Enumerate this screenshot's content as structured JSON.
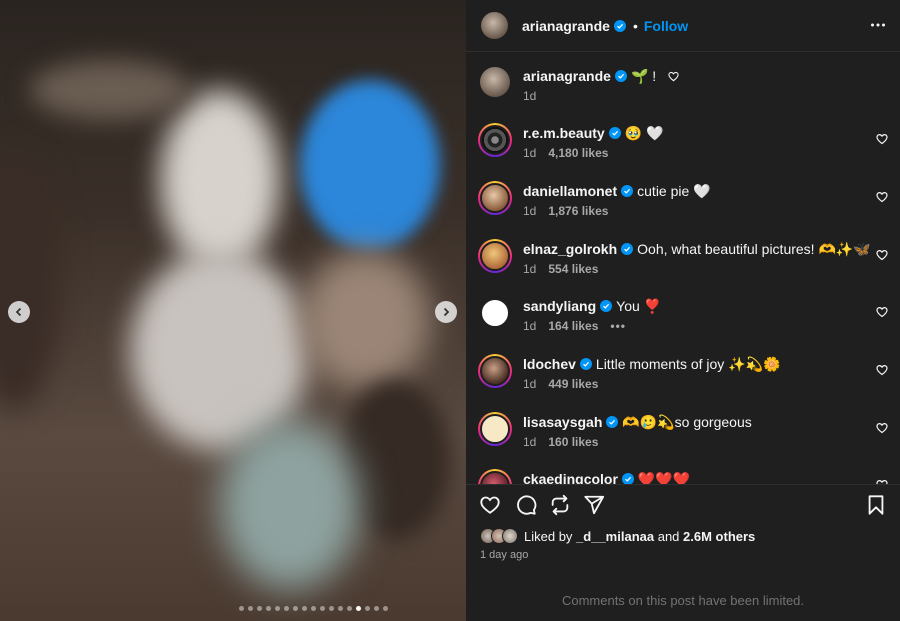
{
  "post": {
    "author": "arianagrande",
    "follow_label": "Follow",
    "separator": "•"
  },
  "caption": {
    "username": "arianagrande",
    "text": "🌱 !",
    "time": "1d"
  },
  "comments": [
    {
      "username": "r.e.m.beauty",
      "text": "🥹 🤍",
      "time": "1d",
      "likes": "4,180 likes"
    },
    {
      "username": "daniellamonet",
      "text": "cutie pie 🤍",
      "time": "1d",
      "likes": "1,876 likes"
    },
    {
      "username": "elnaz_golrokh",
      "text": "Ooh, what beautiful pictures! 🫶✨🦋",
      "time": "1d",
      "likes": "554 likes"
    },
    {
      "username": "sandyliang",
      "text": "You ❣️",
      "time": "1d",
      "likes": "164 likes",
      "more": "•••"
    },
    {
      "username": "ldochev",
      "text": "Little moments of joy ✨💫🌼",
      "time": "1d",
      "likes": "449 likes"
    },
    {
      "username": "lisasaysgah",
      "text": "🫶🥲💫so gorgeous",
      "time": "1d",
      "likes": "160 likes"
    },
    {
      "username": "ckaedingcolor",
      "text": "❤️❤️❤️",
      "time": "",
      "likes": ""
    }
  ],
  "likes_summary": {
    "prefix": "Liked by",
    "user": "_d__milanaa",
    "joiner": "and",
    "others": "2.6M others",
    "time_ago": "1 day ago"
  },
  "comments_limited": "Comments on this post have been limited.",
  "carousel": {
    "total": 17,
    "active": 13
  },
  "colors": {
    "panel_bg": "#1f1f1f",
    "link_blue": "#0095f6",
    "verified_blue": "#0095f6",
    "muted": "#a8a8a8"
  },
  "icons": {
    "header_more": "more-horizontal-icon",
    "prev": "chevron-left-icon",
    "next": "chevron-right-icon",
    "like": "heart-icon",
    "comment": "comment-icon",
    "repost": "repost-icon",
    "share": "share-icon",
    "save": "bookmark-icon"
  }
}
